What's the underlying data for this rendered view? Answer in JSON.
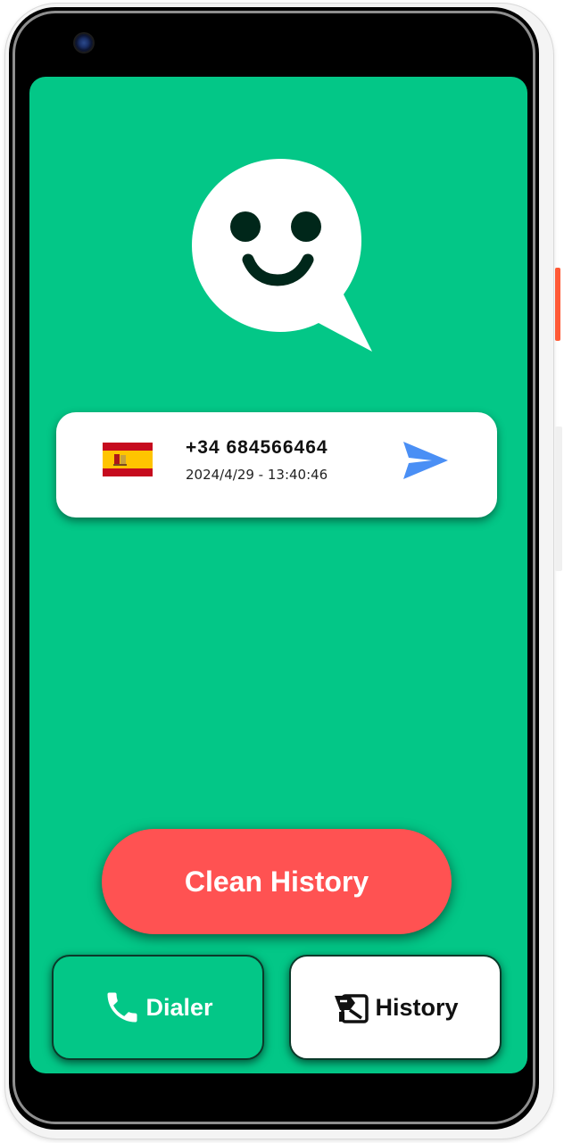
{
  "colors": {
    "screen_bg": "#03c787",
    "clean_button": "#ff5252",
    "send_icon": "#4a8ff5",
    "card_bg": "#ffffff"
  },
  "logo": {
    "icon": "smiley-chat-bubble-icon"
  },
  "history": {
    "items": [
      {
        "flag_icon": "spain-flag-icon",
        "phone": "+34 684566464",
        "datetime": "2024/4/29 - 13:40:46",
        "action_icon": "send-icon"
      }
    ]
  },
  "actions": {
    "clean_history_label": "Clean History"
  },
  "bottom_nav": {
    "dialer": {
      "label": "Dialer",
      "icon": "phone-icon"
    },
    "history": {
      "label": "History",
      "icon": "history-icon"
    }
  }
}
